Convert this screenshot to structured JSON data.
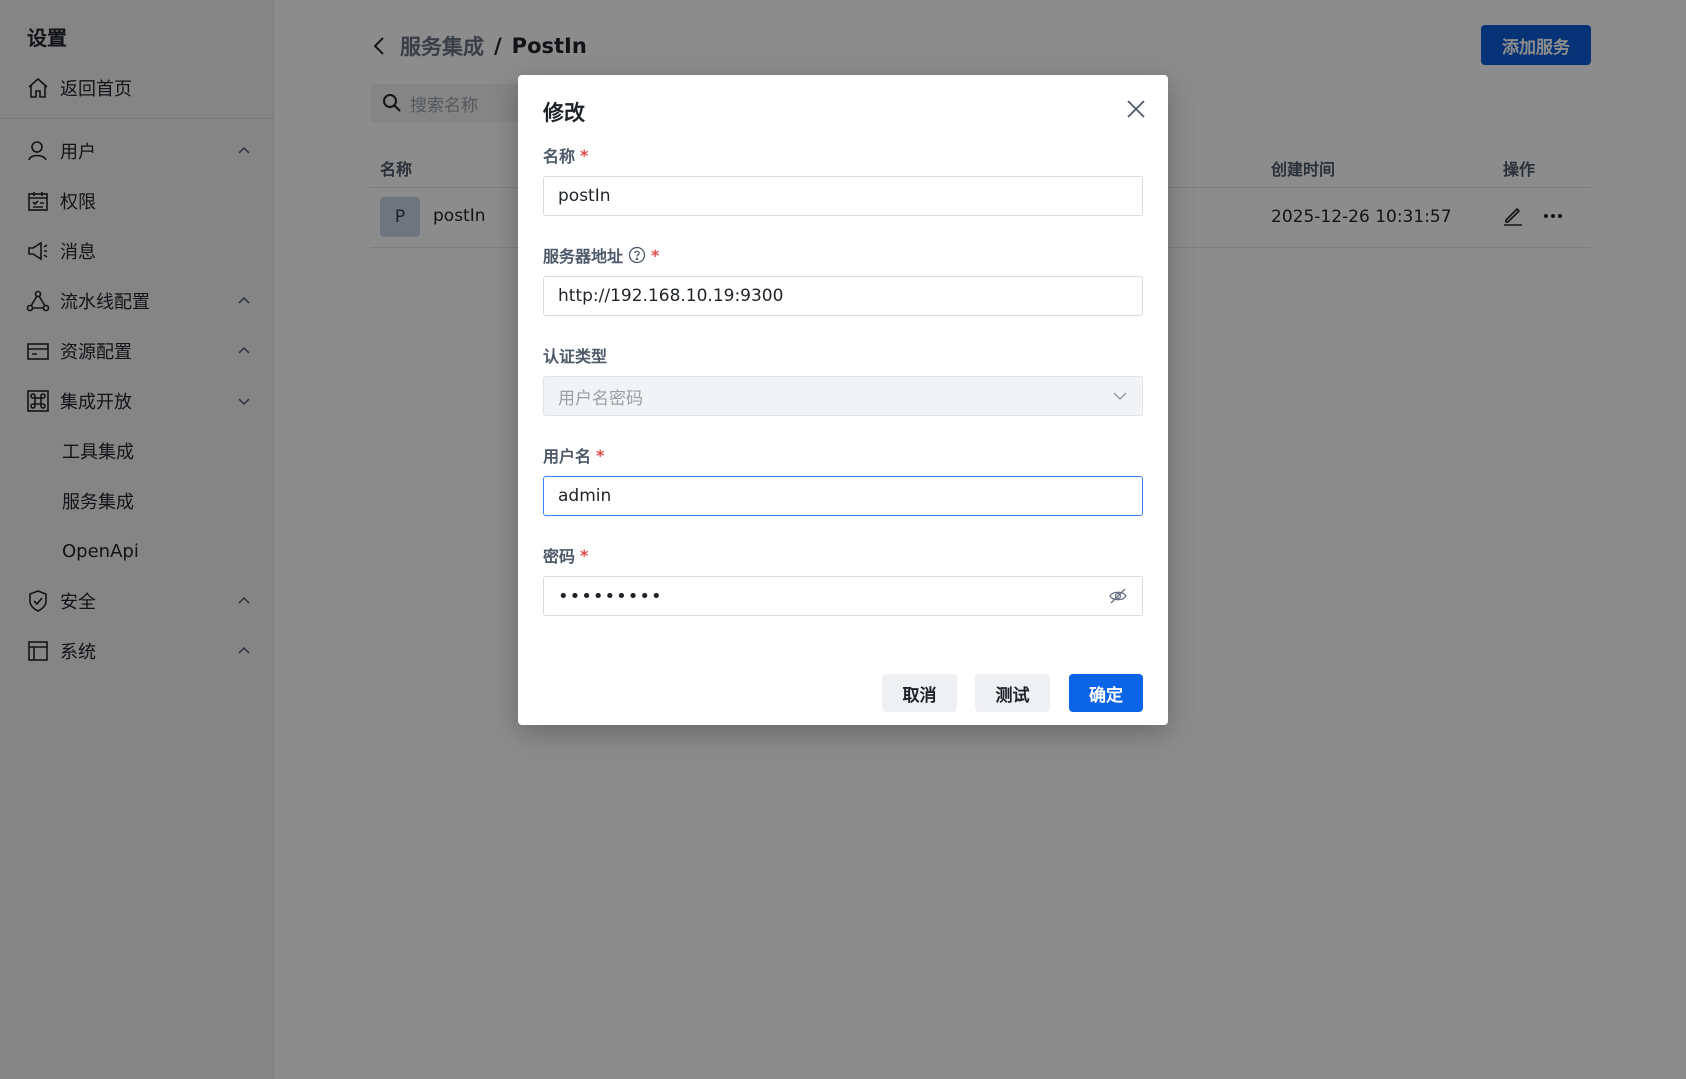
{
  "sidebar": {
    "title": "设置",
    "home": "返回首页",
    "items": [
      {
        "label": "用户"
      },
      {
        "label": "权限"
      },
      {
        "label": "消息"
      },
      {
        "label": "流水线配置"
      },
      {
        "label": "资源配置"
      },
      {
        "label": "集成开放"
      },
      {
        "label": "安全"
      },
      {
        "label": "系统"
      }
    ],
    "sub_items": [
      {
        "label": "工具集成"
      },
      {
        "label": "服务集成"
      },
      {
        "label": "OpenApi"
      }
    ]
  },
  "header": {
    "breadcrumb_parent": "服务集成",
    "breadcrumb_sep": "/",
    "breadcrumb_current": "PostIn",
    "add_button": "添加服务"
  },
  "search": {
    "placeholder": "搜索名称"
  },
  "table": {
    "columns": [
      "名称",
      "创建时间",
      "操作"
    ],
    "rows": [
      {
        "avatar": "P",
        "name": "postIn",
        "created": "2025-12-26 10:31:57"
      }
    ]
  },
  "modal": {
    "title": "修改",
    "fields": {
      "name": {
        "label": "名称",
        "value": "postIn"
      },
      "server": {
        "label": "服务器地址",
        "value": "http://192.168.10.19:9300"
      },
      "auth_type": {
        "label": "认证类型",
        "value": "用户名密码"
      },
      "username": {
        "label": "用户名",
        "value": "admin"
      },
      "password": {
        "label": "密码",
        "value": "•••••••••"
      }
    },
    "required_mark": "*",
    "buttons": {
      "cancel": "取消",
      "test": "测试",
      "ok": "确定"
    }
  },
  "colors": {
    "primary": "#0b63e5",
    "required": "#e5484d",
    "mask": "rgba(0,0,0,0.45)"
  }
}
